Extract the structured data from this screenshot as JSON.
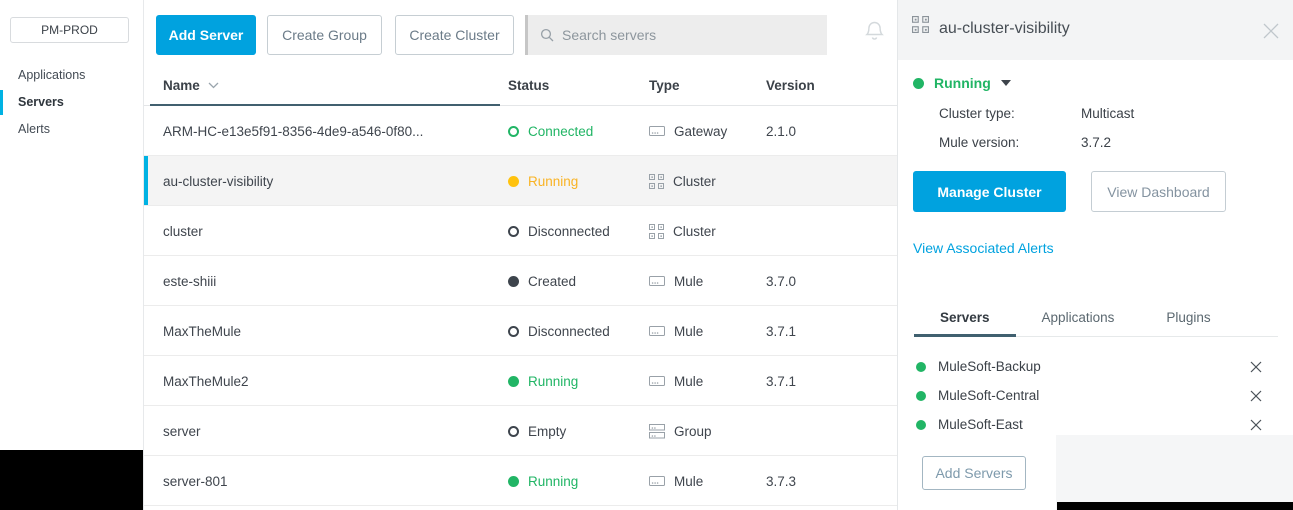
{
  "colors": {
    "accent_blue": "#00a2df",
    "selection_bar": "#00b2e3",
    "green": "#21b565",
    "amber_dot": "#ffc20d",
    "amber_text": "#f9b324",
    "dark_status": "#3d444c",
    "sort_underline": "#41606f",
    "panel_header_bg": "#f3f4f5"
  },
  "sidebar": {
    "env_label": "PM-PROD",
    "items": [
      {
        "label": "Applications",
        "active": false
      },
      {
        "label": "Servers",
        "active": true
      },
      {
        "label": "Alerts",
        "active": false
      }
    ]
  },
  "toolbar": {
    "add_server": "Add Server",
    "create_group": "Create Group",
    "create_cluster": "Create Cluster",
    "search_placeholder": "Search servers",
    "search_value": "",
    "search_icon": "search-icon",
    "bell_icon": "bell-icon"
  },
  "table": {
    "columns": [
      "Name",
      "Status",
      "Type",
      "Version"
    ],
    "sort_column": "Name",
    "sort_icon": "chevron-down-icon",
    "rows": [
      {
        "name": "ARM-HC-e13e5f91-8356-4de9-a546-0f80...",
        "status": "Connected",
        "status_color": "green",
        "status_filled": false,
        "type": "Gateway",
        "type_icon": "gateway-icon",
        "version": "2.1.0",
        "selected": false
      },
      {
        "name": "au-cluster-visibility",
        "status": "Running",
        "status_color": "amber",
        "status_filled": true,
        "type": "Cluster",
        "type_icon": "cluster-icon",
        "version": "",
        "selected": true
      },
      {
        "name": "cluster",
        "status": "Disconnected",
        "status_color": "dark",
        "status_filled": false,
        "type": "Cluster",
        "type_icon": "cluster-icon",
        "version": "",
        "selected": false
      },
      {
        "name": "este-shiii",
        "status": "Created",
        "status_color": "dark",
        "status_filled": true,
        "type": "Mule",
        "type_icon": "mule-icon",
        "version": "3.7.0",
        "selected": false
      },
      {
        "name": "MaxTheMule",
        "status": "Disconnected",
        "status_color": "dark",
        "status_filled": false,
        "type": "Mule",
        "type_icon": "mule-icon",
        "version": "3.7.1",
        "selected": false
      },
      {
        "name": "MaxTheMule2",
        "status": "Running",
        "status_color": "green",
        "status_filled": true,
        "type": "Mule",
        "type_icon": "mule-icon",
        "version": "3.7.1",
        "selected": false
      },
      {
        "name": "server",
        "status": "Empty",
        "status_color": "dark",
        "status_filled": false,
        "type": "Group",
        "type_icon": "group-icon",
        "version": "",
        "selected": false
      },
      {
        "name": "server-801",
        "status": "Running",
        "status_color": "green",
        "status_filled": true,
        "type": "Mule",
        "type_icon": "mule-icon",
        "version": "3.7.3",
        "selected": false
      }
    ]
  },
  "panel": {
    "title": "au-cluster-visibility",
    "title_icon": "cluster-icon",
    "close_icon": "close-icon",
    "status": {
      "label": "Running",
      "color": "green",
      "dropdown_icon": "caret-down-icon"
    },
    "details": [
      {
        "label": "Cluster type:",
        "value": "Multicast"
      },
      {
        "label": "Mule version:",
        "value": "3.7.2"
      }
    ],
    "buttons": {
      "primary": "Manage Cluster",
      "secondary": "View Dashboard"
    },
    "alerts_link": "View Associated Alerts",
    "tabs": [
      {
        "label": "Servers",
        "active": true
      },
      {
        "label": "Applications",
        "active": false
      },
      {
        "label": "Plugins",
        "active": false
      }
    ],
    "servers": [
      {
        "name": "MuleSoft-Backup",
        "status_color": "green",
        "remove_icon": "close-icon"
      },
      {
        "name": "MuleSoft-Central",
        "status_color": "green",
        "remove_icon": "close-icon"
      },
      {
        "name": "MuleSoft-East",
        "status_color": "green",
        "remove_icon": "close-icon"
      }
    ],
    "add_servers": "Add Servers"
  }
}
